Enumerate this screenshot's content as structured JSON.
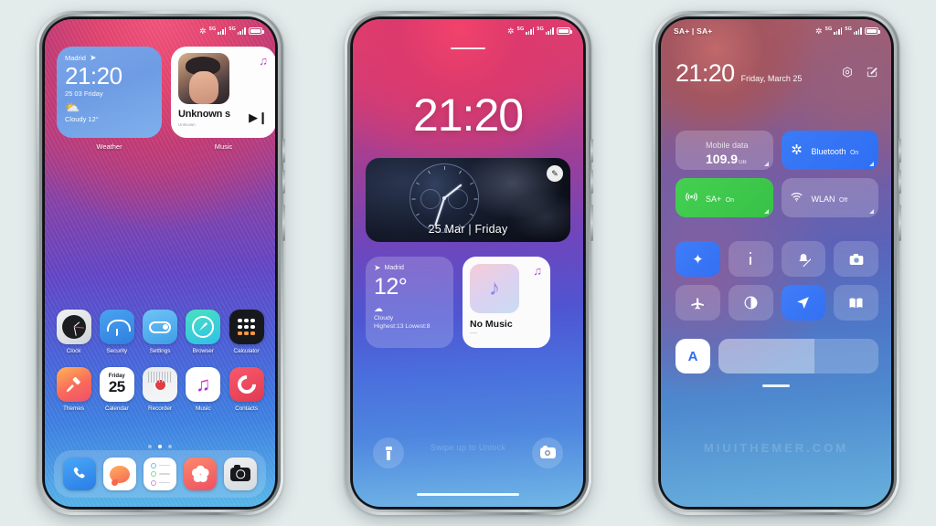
{
  "page": {
    "background_color": "#e4ebeb",
    "watermark": "MIUITHEMER.COM"
  },
  "phone1": {
    "name": "home-screen",
    "statusbar": {
      "left": "",
      "signal1": "5G",
      "signal2": "5G",
      "bluetooth_icon": "bluetooth-icon"
    },
    "weather_widget": {
      "location": "Madrid",
      "time": "21:20",
      "date": "25 03 Friday",
      "condition": "Cloudy 12°",
      "icon": "sun-cloud-icon",
      "label": "Weather"
    },
    "music_widget": {
      "title": "Unknown s",
      "subtitle": "Unknown",
      "note_icon": "music-note-icon",
      "play_icon": "play-next-icon",
      "label": "Music"
    },
    "apps_row1": [
      {
        "label": "Clock",
        "icon": "clock-icon"
      },
      {
        "label": "Security",
        "icon": "umbrella-icon"
      },
      {
        "label": "Settings",
        "icon": "toggle-switch-icon"
      },
      {
        "label": "Browser",
        "icon": "compass-icon"
      },
      {
        "label": "Calculator",
        "icon": "calculator-icon"
      }
    ],
    "apps_row2": [
      {
        "label": "Themes",
        "icon": "paintbrush-icon"
      },
      {
        "label": "Calendar",
        "icon": "calendar-icon",
        "weekday": "Friday",
        "day": "25"
      },
      {
        "label": "Recorder",
        "icon": "record-icon"
      },
      {
        "label": "Music",
        "icon": "music-note-icon"
      },
      {
        "label": "Contacts",
        "icon": "contacts-icon"
      }
    ],
    "page_dots": {
      "count": 3,
      "active": 2
    },
    "dock": [
      {
        "name": "phone-app",
        "icon": "phone-handset-icon"
      },
      {
        "name": "messages-app",
        "icon": "speech-bubble-icon"
      },
      {
        "name": "notes-app",
        "icon": "checklist-icon"
      },
      {
        "name": "gallery-app",
        "icon": "flower-icon"
      },
      {
        "name": "camera-app",
        "icon": "camera-icon"
      }
    ]
  },
  "phone2": {
    "name": "lock-screen",
    "statusbar": {
      "signal1": "5G",
      "signal2": "5G",
      "bluetooth_icon": "bluetooth-icon"
    },
    "time": "21:20",
    "clock_card": {
      "date": "25 Mar | Friday",
      "edit_icon": "pencil-icon"
    },
    "weather_widget": {
      "location": "Madrid",
      "temperature": "12°",
      "condition": "Cloudy",
      "high_low": "Highest:13 Lowest:8",
      "icon": "cloud-icon"
    },
    "music_widget": {
      "title": "No Music",
      "dash": "—",
      "note_icon": "music-note-icon"
    },
    "swipe_hint": "Swipe up to Unlock",
    "actions": [
      {
        "name": "flashlight-button",
        "icon": "flashlight-icon"
      },
      {
        "name": "camera-button",
        "icon": "camera-icon"
      }
    ]
  },
  "phone3": {
    "name": "control-center",
    "statusbar": {
      "carrier": "SA+ | SA+",
      "bluetooth_icon": "bluetooth-icon"
    },
    "time": "21:20",
    "date": "Friday, March 25",
    "header_icons": [
      {
        "name": "settings-gear-icon",
        "glyph": "gear-icon"
      },
      {
        "name": "edit-icon",
        "glyph": "pencil-square-icon"
      }
    ],
    "tiles": [
      {
        "title": "Mobile data",
        "value": "109.9",
        "unit": "GB",
        "state": "off",
        "icon": "water-drop-icon"
      },
      {
        "title": "Bluetooth",
        "sub": "On",
        "state": "on-blue",
        "icon": "bluetooth-icon"
      },
      {
        "title": "SA+",
        "sub": "On",
        "state": "on-green",
        "icon": "cellular-broadcast-icon"
      },
      {
        "title": "WLAN",
        "sub": "Off",
        "state": "off",
        "icon": "wifi-icon"
      }
    ],
    "quick_buttons": [
      {
        "name": "sparkle-button",
        "icon": "sparkle-icon",
        "state": "on"
      },
      {
        "name": "more-button",
        "icon": "vertical-dots-icon",
        "state": "off"
      },
      {
        "name": "mute-button",
        "icon": "bell-slash-icon",
        "state": "off"
      },
      {
        "name": "screenshot-button",
        "icon": "camera-icon",
        "state": "off"
      },
      {
        "name": "airplane-button",
        "icon": "airplane-icon",
        "state": "off"
      },
      {
        "name": "dark-mode-button",
        "icon": "half-circle-icon",
        "state": "off"
      },
      {
        "name": "location-button",
        "icon": "location-arrow-icon",
        "state": "on"
      },
      {
        "name": "reading-mode-button",
        "icon": "book-icon",
        "state": "off"
      }
    ],
    "brightness": {
      "auto_label": "A",
      "level_percent": 60
    }
  }
}
